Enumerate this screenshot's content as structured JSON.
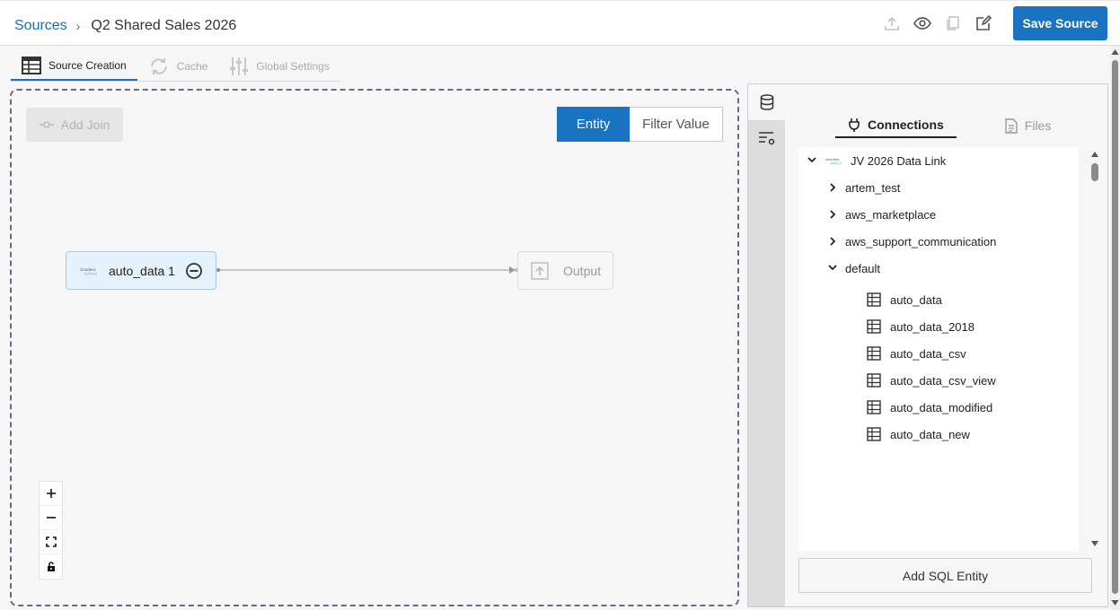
{
  "breadcrumb": {
    "root": "Sources",
    "current": "Q2 Shared Sales 2026"
  },
  "header": {
    "icons": [
      "upload-icon",
      "eye-icon",
      "copy-icon",
      "edit-icon"
    ],
    "save_label": "Save Source"
  },
  "tabs": [
    {
      "label": "Source Creation",
      "icon": "table-icon",
      "active": true
    },
    {
      "label": "Cache",
      "icon": "refresh-icon",
      "active": false
    },
    {
      "label": "Global Settings",
      "icon": "sliders-icon",
      "active": false
    }
  ],
  "canvas": {
    "add_join_label": "Add Join",
    "toggle": {
      "entity": "Entity",
      "filter": "Filter Value",
      "selected": "Entity"
    },
    "source_node": {
      "label": "auto_data 1",
      "logo": "cloudera-logo"
    },
    "output_node": {
      "label": "Output"
    },
    "zoom_controls": [
      "plus-icon",
      "minus-icon",
      "fit-view-icon",
      "lock-icon"
    ]
  },
  "panel": {
    "tabs": [
      {
        "label": "Connections",
        "active": true
      },
      {
        "label": "Files",
        "active": false
      }
    ],
    "tree": {
      "connection": "JV 2026 Data Link",
      "databases": [
        {
          "name": "artem_test",
          "expanded": false
        },
        {
          "name": "aws_marketplace",
          "expanded": false
        },
        {
          "name": "aws_support_communication",
          "expanded": false
        },
        {
          "name": "default",
          "expanded": true
        }
      ],
      "tables": [
        "auto_data",
        "auto_data_2018",
        "auto_data_csv",
        "auto_data_csv_view",
        "auto_data_modified",
        "auto_data_new"
      ]
    },
    "add_sql_label": "Add SQL Entity"
  },
  "colors": {
    "accent": "#1a73c1",
    "link": "#1a6fb0",
    "node_fill": "#e6f2fb"
  }
}
